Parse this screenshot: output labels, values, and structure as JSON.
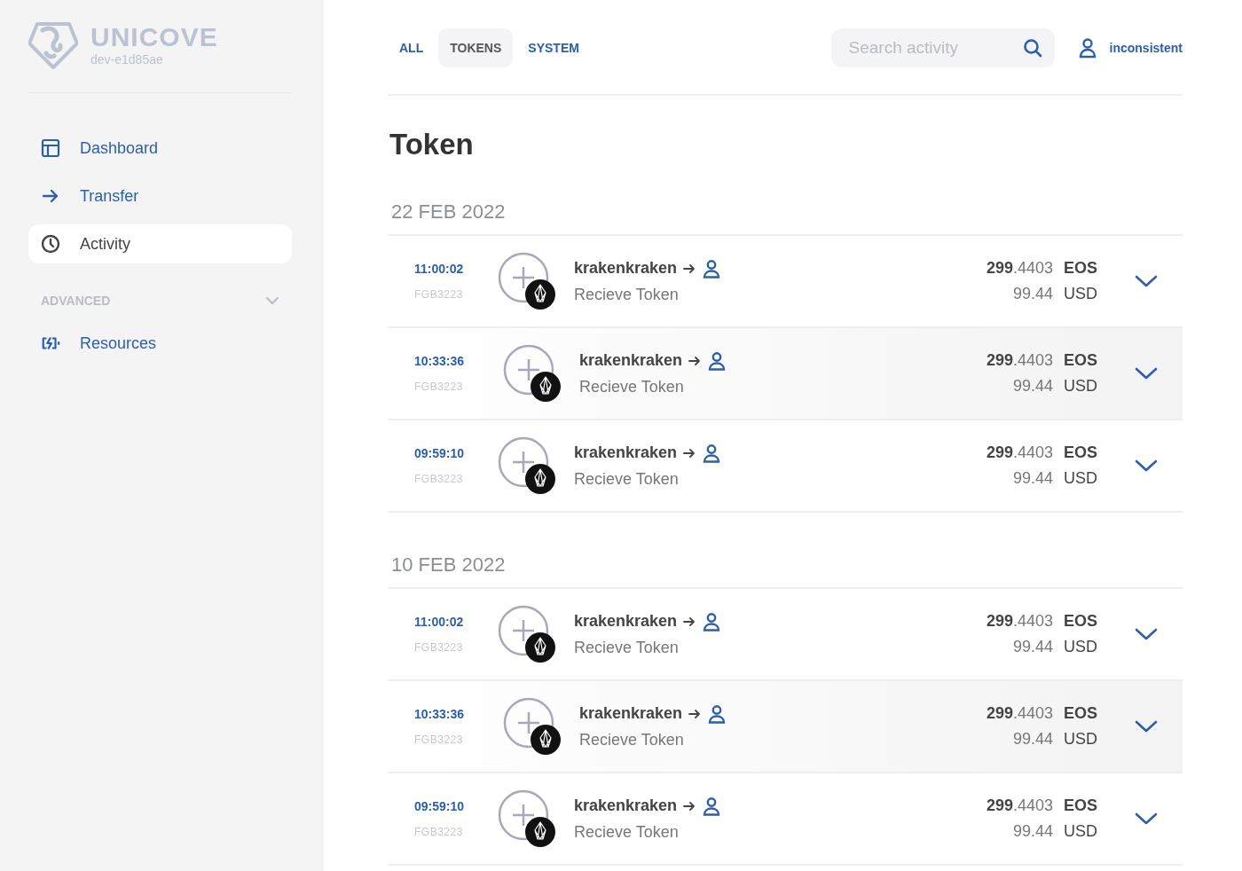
{
  "sidebar": {
    "logo": {
      "name": "UNICOVE",
      "subtitle": "dev-e1d85ae"
    },
    "items": [
      {
        "label": "Dashboard",
        "kind": "dashboard",
        "selected": false
      },
      {
        "label": "Transfer",
        "kind": "arrow",
        "selected": false
      },
      {
        "label": "Activity",
        "kind": "clock",
        "selected": true
      }
    ],
    "section": {
      "title": "ADVANCED",
      "expanded": true,
      "items": [
        {
          "label": "Resources",
          "kind": "battery",
          "selected": false
        }
      ]
    }
  },
  "tabs": [
    {
      "label": "ALL",
      "selected": false
    },
    {
      "label": "TOKENS",
      "selected": true
    },
    {
      "label": "SYSTEM",
      "selected": false
    }
  ],
  "search": {
    "placeholder": "Search activity"
  },
  "account": {
    "name": "inconsistent"
  },
  "title": "Token",
  "groups": [
    {
      "date": "22 FEB 2022",
      "rows": [
        {
          "time": "11:00:02",
          "id": "FGB3223",
          "account": "krakenkraken",
          "action": "Recieve Token",
          "amount": "**299**.4403",
          "symbol": "EOS",
          "value": "99.44",
          "currency": "USD",
          "highlighted": false
        },
        {
          "time": "10:33:36",
          "id": "FGB3223",
          "account": "krakenkraken",
          "action": "Recieve Token",
          "amount": "**299**.4403",
          "symbol": "EOS",
          "value": "99.44",
          "currency": "USD",
          "highlighted": true
        },
        {
          "time": "09:59:10",
          "id": "FGB3223",
          "account": "krakenkraken",
          "action": "Recieve Token",
          "amount": "**299**.4403",
          "symbol": "EOS",
          "value": "99.44",
          "currency": "USD",
          "highlighted": false
        }
      ]
    },
    {
      "date": "10 FEB 2022",
      "rows": [
        {
          "time": "11:00:02",
          "id": "FGB3223",
          "account": "krakenkraken",
          "action": "Recieve Token",
          "amount": "**299**.4403",
          "symbol": "EOS",
          "value": "99.44",
          "currency": "USD",
          "highlighted": false
        },
        {
          "time": "10:33:36",
          "id": "FGB3223",
          "account": "krakenkraken",
          "action": "Recieve Token",
          "amount": "**299**.4403",
          "symbol": "EOS",
          "value": "99.44",
          "currency": "USD",
          "highlighted": true
        },
        {
          "time": "09:59:10",
          "id": "FGB3223",
          "account": "krakenkraken",
          "action": "Recieve Token",
          "amount": "**299**.4403",
          "symbol": "EOS",
          "value": "99.44",
          "currency": "USD",
          "highlighted": false
        }
      ]
    }
  ]
}
